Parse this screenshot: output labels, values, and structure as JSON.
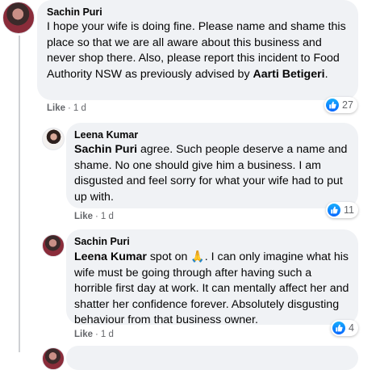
{
  "comments": [
    {
      "author": "Sachin Puri",
      "text_before": "I hope your wife is doing fine. Please name and shame this place so that we are all aware about this business and never shop there. Also, please report this incident to Food Authority NSW as previously advised by ",
      "mention": "Aarti Betigeri",
      "text_after": ".",
      "like_label": "Like",
      "separator": "·",
      "time": "1 d",
      "reaction_count": "27"
    },
    {
      "author": "Leena Kumar",
      "mention": "Sachin Puri",
      "text_after": " agree. Such people deserve a name and shame. No one should give him a business. I am disgusted and feel sorry for what your wife had to put up with.",
      "like_label": "Like",
      "separator": "·",
      "time": "1 d",
      "reaction_count": "11"
    },
    {
      "author": "Sachin Puri",
      "mention": "Leena Kumar",
      "text_middle": " spot on ",
      "emoji": "🙏",
      "text_after": ". I can only imagine what his wife must be going through after having such a horrible first day at work. It can mentally affect her and shatter her confidence forever. Absolutely disgusting behaviour from that business owner.",
      "like_label": "Like",
      "separator": "·",
      "time": "1 d",
      "reaction_count": "4"
    }
  ],
  "colors": {
    "bubble": "#f0f2f5",
    "like_blue": "#0866ff",
    "meta_gray": "#65676b"
  },
  "icons": [
    "like-reaction-icon",
    "avatar"
  ]
}
